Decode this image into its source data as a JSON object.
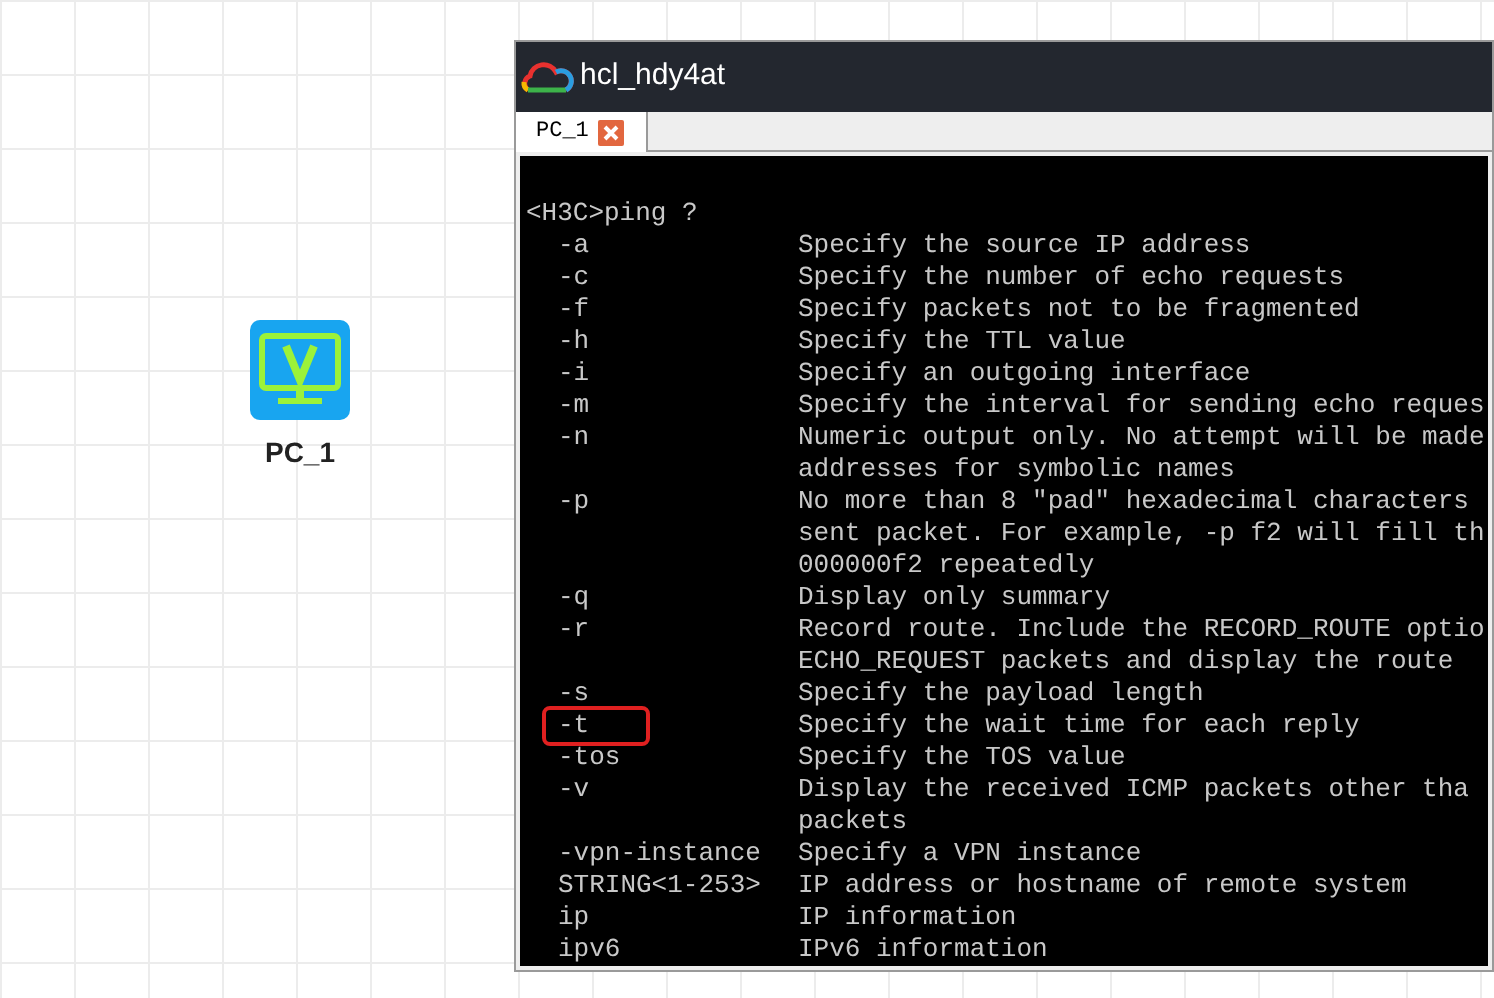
{
  "canvas": {
    "nodes": [
      {
        "label": "PC_1"
      }
    ]
  },
  "window": {
    "title": "hcl_hdy4at"
  },
  "tabs": [
    {
      "label": "PC_1",
      "selected": true
    }
  ],
  "terminal": {
    "command": "<H3C>ping ?",
    "rows": [
      {
        "option": "-a",
        "description": [
          "Specify the source IP address"
        ],
        "highlighted": false
      },
      {
        "option": "-c",
        "description": [
          "Specify the number of echo requests"
        ],
        "highlighted": false
      },
      {
        "option": "-f",
        "description": [
          "Specify packets not to be fragmented"
        ],
        "highlighted": false
      },
      {
        "option": "-h",
        "description": [
          "Specify the TTL value"
        ],
        "highlighted": false
      },
      {
        "option": "-i",
        "description": [
          "Specify an outgoing interface"
        ],
        "highlighted": false
      },
      {
        "option": "-m",
        "description": [
          "Specify the interval for sending echo reques"
        ],
        "highlighted": false
      },
      {
        "option": "-n",
        "description": [
          "Numeric output only. No attempt will be made",
          "addresses for symbolic names"
        ],
        "highlighted": false
      },
      {
        "option": "-p",
        "description": [
          "No more than 8 \"pad\" hexadecimal characters",
          "sent packet. For example, -p f2 will fill th",
          "000000f2 repeatedly"
        ],
        "highlighted": false
      },
      {
        "option": "-q",
        "description": [
          "Display only summary"
        ],
        "highlighted": false
      },
      {
        "option": "-r",
        "description": [
          "Record route. Include the RECORD_ROUTE optio",
          "ECHO_REQUEST packets and display the route"
        ],
        "highlighted": false
      },
      {
        "option": "-s",
        "description": [
          "Specify the payload length"
        ],
        "highlighted": false
      },
      {
        "option": "-t",
        "description": [
          "Specify the wait time for each reply"
        ],
        "highlighted": true
      },
      {
        "option": "-tos",
        "description": [
          "Specify the TOS value"
        ],
        "highlighted": false
      },
      {
        "option": "-v",
        "description": [
          "Display the received ICMP packets other tha",
          "packets"
        ],
        "highlighted": false
      },
      {
        "option": "-vpn-instance",
        "description": [
          "Specify a VPN instance"
        ],
        "highlighted": false
      },
      {
        "option": "STRING<1-253>",
        "description": [
          "IP address or hostname of remote system"
        ],
        "highlighted": false
      },
      {
        "option": "ip",
        "description": [
          "IP information"
        ],
        "highlighted": false
      },
      {
        "option": "ipv6",
        "description": [
          "IPv6 information"
        ],
        "highlighted": false
      }
    ]
  }
}
